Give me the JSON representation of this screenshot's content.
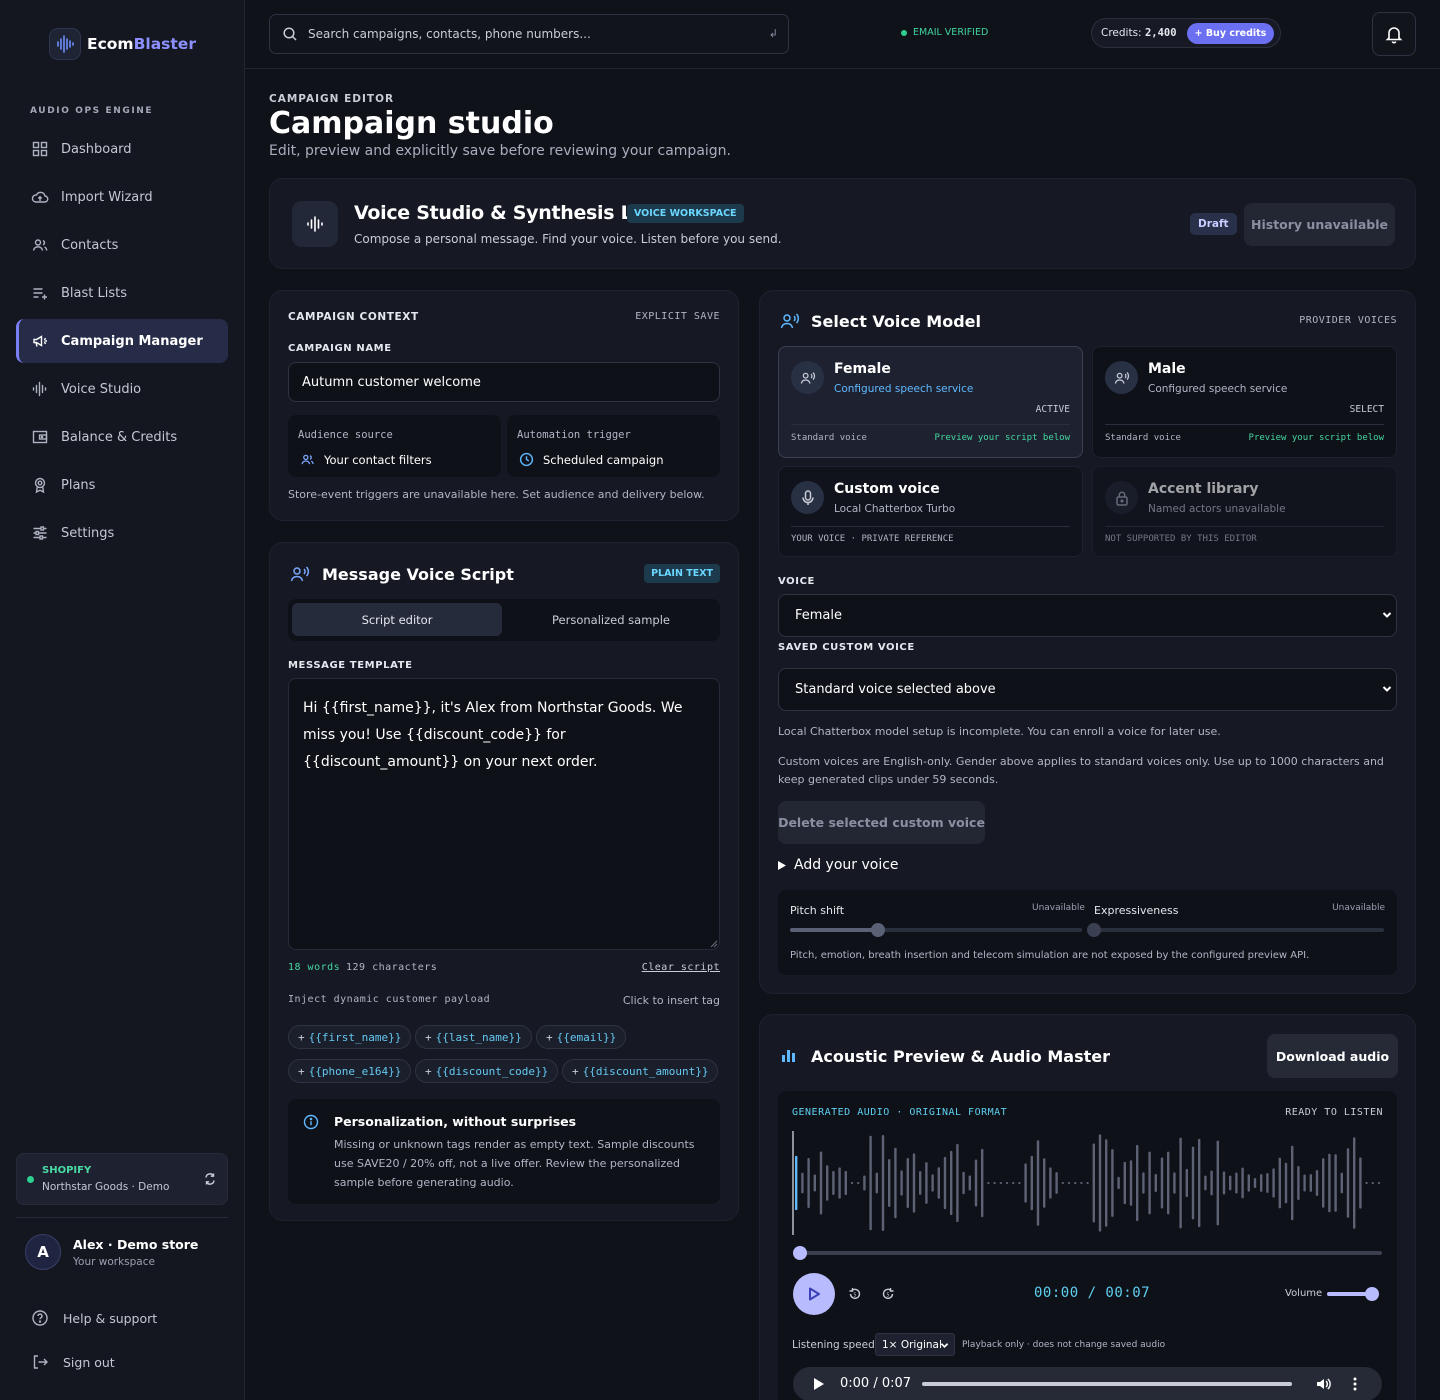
{
  "app": {
    "brand_part1": "Ecom",
    "brand_part2": "Blaster",
    "engine_label": "AUDIO OPS ENGINE"
  },
  "sidebar": {
    "items": [
      {
        "label": "Dashboard",
        "icon": "grid-icon"
      },
      {
        "label": "Import Wizard",
        "icon": "cloud-upload-icon"
      },
      {
        "label": "Contacts",
        "icon": "users-icon"
      },
      {
        "label": "Blast Lists",
        "icon": "list-add-icon"
      },
      {
        "label": "Campaign Manager",
        "icon": "megaphone-icon",
        "active": true
      },
      {
        "label": "Voice Studio",
        "icon": "waveform-icon"
      },
      {
        "label": "Balance & Credits",
        "icon": "wallet-icon"
      },
      {
        "label": "Plans",
        "icon": "badge-icon"
      },
      {
        "label": "Settings",
        "icon": "sliders-icon"
      }
    ],
    "store": {
      "platform": "SHOPIFY",
      "name": "Northstar Goods · Demo"
    },
    "user": {
      "initial": "A",
      "name": "Alex · Demo store",
      "workspace": "Your workspace"
    },
    "help": "Help & support",
    "signout": "Sign out"
  },
  "topbar": {
    "search_placeholder": "Search campaigns, contacts, phone numbers...",
    "enter_hint": "↲",
    "email_status": "EMAIL VERIFIED",
    "credits_label": "Credits:",
    "credits_value": "2,400",
    "buy_label": "+ Buy credits"
  },
  "page": {
    "eyebrow": "CAMPAIGN EDITOR",
    "title": "Campaign studio",
    "subtitle": "Edit, preview and explicitly save before reviewing your campaign."
  },
  "studio": {
    "title": "Voice Studio & Synthesis Lab",
    "badge": "VOICE WORKSPACE",
    "subtitle": "Compose a personal message. Find your voice. Listen before you send.",
    "status": "Draft",
    "history": "History unavailable"
  },
  "context": {
    "title": "CAMPAIGN CONTEXT",
    "save_mode": "EXPLICIT SAVE",
    "name_label": "CAMPAIGN NAME",
    "name_value": "Autumn customer welcome",
    "audience_label": "Audience source",
    "audience_value": "Your contact filters",
    "trigger_label": "Automation trigger",
    "trigger_value": "Scheduled campaign",
    "note": "Store-event triggers are unavailable here. Set audience and delivery below."
  },
  "script": {
    "title": "Message Voice Script",
    "badge": "PLAIN TEXT",
    "tabs": [
      "Script editor",
      "Personalized sample"
    ],
    "template_label": "MESSAGE TEMPLATE",
    "text": "Hi {{first_name}}, it's Alex from Northstar Goods. We miss you! Use {{discount_code}} for {{discount_amount}} on your next order.",
    "words": "18 words",
    "chars": "129 characters",
    "clear": "Clear script",
    "payload_label": "Inject dynamic customer payload",
    "insert_hint": "Click to insert tag",
    "tags": [
      "{{first_name}}",
      "{{last_name}}",
      "{{email}}",
      "{{phone_e164}}",
      "{{discount_code}}",
      "{{discount_amount}}"
    ],
    "tip_title": "Personalization, without surprises",
    "tip_text": "Missing or unknown tags render as empty text. Sample discounts use SAVE20 / 20% off, not a live offer. Review the personalized sample before generating audio."
  },
  "voice": {
    "title": "Select Voice Model",
    "provider": "PROVIDER VOICES",
    "cards": [
      {
        "name": "Female",
        "desc": "Configured speech service",
        "state": "ACTIVE",
        "foot_l": "Standard voice",
        "foot_r": "Preview your script below",
        "icon": "voice-person-icon"
      },
      {
        "name": "Male",
        "desc": "Configured speech service",
        "state": "SELECT",
        "foot_l": "Standard voice",
        "foot_r": "Preview your script below",
        "icon": "voice-person-icon"
      },
      {
        "name": "Custom voice",
        "desc": "Local Chatterbox Turbo",
        "foot_l": "YOUR VOICE · PRIVATE REFERENCE",
        "icon": "microphone-icon"
      },
      {
        "name": "Accent library",
        "desc": "Named actors unavailable",
        "foot_l": "NOT SUPPORTED BY THIS EDITOR",
        "icon": "lock-icon"
      }
    ],
    "voice_label": "VOICE",
    "voice_value": "Female",
    "saved_label": "SAVED CUSTOM VOICE",
    "saved_value": "Standard voice selected above",
    "note1": "Local Chatterbox model setup is incomplete. You can enroll a voice for later use.",
    "note2": "Custom voices are English-only. Gender above applies to standard voices only. Use up to 1000 characters and keep generated clips under 59 seconds.",
    "delete": "Delete selected custom voice",
    "add": "Add your voice",
    "pitch": "Pitch shift",
    "pitch_state": "Unavailable",
    "pitch_level": 0.3,
    "express": "Expressiveness",
    "express_state": "Unavailable",
    "express_level": 0,
    "fx_note": "Pitch, emotion, breath insertion and telecom simulation are not exposed by the configured preview API."
  },
  "preview": {
    "title": "Acoustic Preview & Audio Master",
    "download": "Download audio",
    "format": "GENERATED AUDIO · ORIGINAL FORMAT",
    "status": "READY TO LISTEN",
    "time": "00:00 / 00:07",
    "volume_label": "Volume",
    "volume_level": 0.9,
    "progress": 0,
    "speed_label": "Listening speed",
    "speed_value": "1× Original",
    "speed_note": "Playback only · does not change saved audio",
    "native_time": "0:00 / 0:07"
  }
}
